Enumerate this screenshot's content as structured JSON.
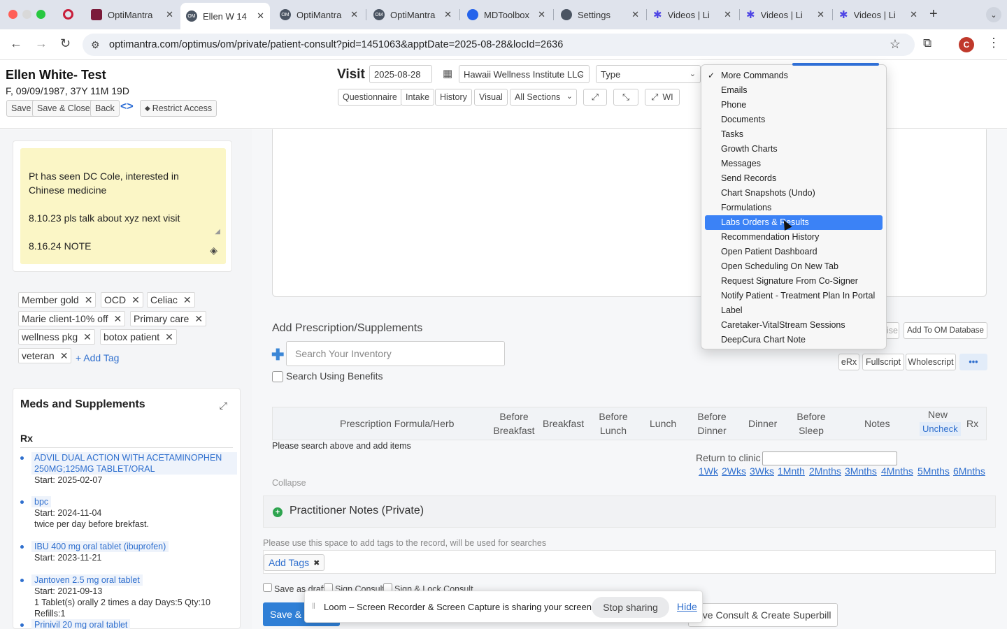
{
  "browser": {
    "tabs": [
      {
        "title": "OptiMantra",
        "icon": "optimantra-favicon"
      },
      {
        "title": "Ellen W 14",
        "icon": "om-favicon"
      },
      {
        "title": "OptiMantra",
        "icon": "om-favicon"
      },
      {
        "title": "OptiMantra",
        "icon": "om-favicon"
      },
      {
        "title": "MDToolbox",
        "icon": "mdtoolbox-favicon"
      },
      {
        "title": "Settings",
        "icon": "settings-favicon"
      },
      {
        "title": "Videos | Li",
        "icon": "gear-icon"
      },
      {
        "title": "Videos | Li",
        "icon": "gear-icon"
      },
      {
        "title": "Videos | Li",
        "icon": "gear-icon"
      }
    ],
    "new_tab": "+",
    "url": "optimantra.com/optimus/om/private/patient-consult?pid=1451063&apptDate=2025-08-28&locId=2636",
    "profile_initial": "C",
    "om_badge": "OM"
  },
  "patient": {
    "name": "Ellen White- Test",
    "info": "F,  09/09/1987,  37Y 11M 19D"
  },
  "header_buttons": {
    "save": "Save",
    "save_close": "Save & Close",
    "back": "Back",
    "restrict": "Restrict Access"
  },
  "visit": {
    "label": "Visit",
    "date": "2025-08-28",
    "location": "Hawaii Wellness Institute LLC",
    "type": "Type"
  },
  "section_buttons": {
    "questionnaire": "Questionnaire",
    "intake": "Intake",
    "history": "History",
    "visual": "Visual",
    "all_sections": "All Sections",
    "wi": "WI"
  },
  "note": {
    "text": "Pt has seen DC Cole, interested in Chinese medicine\n\n8.10.23 pls talk about xyz next visit\n\n8.16.24 NOTE"
  },
  "tags": {
    "items": [
      "Member gold",
      "OCD",
      "Celiac",
      "Marie client-10% off",
      "Primary care",
      "wellness pkg",
      "botox patient",
      "veteran"
    ],
    "add_label": "+ Add Tag"
  },
  "meds": {
    "title": "Meds and Supplements",
    "rx_label": "Rx",
    "items": [
      {
        "name": "ADVIL DUAL ACTION WITH ACETAMINOPHEN 250MG;125MG TABLET/ORAL",
        "start": "Start: 2025-02-07",
        "note": ""
      },
      {
        "name": "bpc",
        "start": "Start: 2024-11-04",
        "note": "twice per day before brekfast."
      },
      {
        "name": "IBU 400 mg oral tablet (ibuprofen)",
        "start": "Start: 2023-11-21",
        "note": ""
      },
      {
        "name": "Jantoven 2.5 mg oral tablet",
        "start": "Start: 2021-09-13",
        "note": "1 Tablet(s) orally 2 times a day Days:5 Qty:10 Refills:1"
      },
      {
        "name": "Prinivil 20 mg oral tablet",
        "start": "",
        "note": ""
      }
    ]
  },
  "prescription": {
    "title": "Add Prescription/Supplements",
    "search_placeholder": "Search Your Inventory",
    "benefits_label": "Search Using Benefits",
    "partial_label": "ise",
    "add_db": "Add To OM Database",
    "erx": "eRx",
    "fullscript": "Fullscript",
    "wholescript": "Wholescript",
    "more": "•••",
    "columns": {
      "formula": "Prescription Formula/Herb",
      "before_breakfast": "Before Breakfast",
      "breakfast": "Breakfast",
      "before_lunch": "Before Lunch",
      "lunch": "Lunch",
      "before_dinner": "Before Dinner",
      "dinner": "Dinner",
      "before_sleep": "Before Sleep",
      "notes": "Notes",
      "new": "New",
      "uncheck": "Uncheck",
      "rx": "Rx"
    },
    "empty": "Please search above and add items",
    "return_label": "Return to clinic",
    "return_links": [
      "1Wk",
      "2Wks",
      "3Wks",
      "1Mnth",
      "2Mnths",
      "3Mnths",
      "4Mnths",
      "5Mnths",
      "6Mnths"
    ],
    "collapse": "Collapse"
  },
  "practitioner": {
    "title": "Practitioner Notes (Private)",
    "hint": "Please use this space to add tags to the record, will be used for searches",
    "add_tags": "Add Tags",
    "draft": "Save as draft",
    "sign": "Sign Consult",
    "sign_lock": "Sign & Lock Consult",
    "save_partial": "Save & C",
    "superbill": "ave Consult & Create Superbill"
  },
  "menu": {
    "items": [
      {
        "label": "More Commands",
        "checked": true
      },
      {
        "label": "Emails"
      },
      {
        "label": "Phone"
      },
      {
        "label": "Documents"
      },
      {
        "label": "Tasks"
      },
      {
        "label": "Growth Charts"
      },
      {
        "label": "Messages"
      },
      {
        "label": "Send Records"
      },
      {
        "label": "Chart Snapshots (Undo)"
      },
      {
        "label": "Formulations"
      },
      {
        "label": "Labs Orders & Results",
        "selected": true
      },
      {
        "label": "Recommendation History"
      },
      {
        "label": "Open Patient Dashboard"
      },
      {
        "label": "Open Scheduling On New Tab"
      },
      {
        "label": "Request Signature From Co-Signer"
      },
      {
        "label": "Notify Patient - Treatment Plan In Portal"
      },
      {
        "label": "Label"
      },
      {
        "label": "Caretaker-VitalStream Sessions"
      },
      {
        "label": "DeepCura Chart Note"
      }
    ]
  },
  "loom": {
    "message": "Loom – Screen Recorder & Screen Capture is sharing your screen.",
    "stop": "Stop sharing",
    "hide": "Hide"
  },
  "colors": {
    "accent": "#2f6fce",
    "selected": "#3b82f6",
    "note_bg": "#fbf6c6"
  }
}
